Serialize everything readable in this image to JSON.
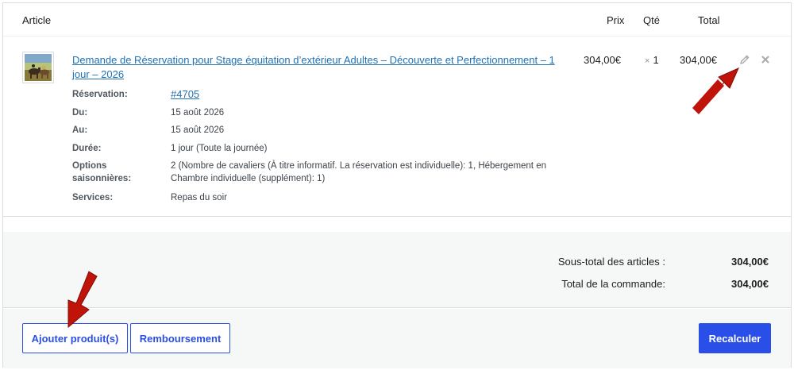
{
  "table": {
    "col_article": "Article",
    "col_prix": "Prix",
    "col_qte": "Qté",
    "col_total": "Total"
  },
  "item": {
    "title": "Demande de Réservation pour Stage équitation d’extérieur Adultes – Découverte et Perfectionnement – 1 jour – 2026",
    "unit_price": "304,00€",
    "qty_symbol": "×",
    "qty": "1",
    "line_total": "304,00€",
    "edit_icon": "pencil-icon",
    "delete_icon": "close-icon",
    "meta": [
      {
        "key": "Réservation:",
        "value": "#4705"
      },
      {
        "key": "Du:",
        "value": "15 août 2026"
      },
      {
        "key": "Au:",
        "value": "15 août 2026"
      },
      {
        "key": "Durée:",
        "value": "1 jour (Toute la journée)"
      },
      {
        "key": "Options saisonnières:",
        "value": "2 (Nombre de cavaliers (À titre informatif. La réservation est individuelle): 1, Hébergement en Chambre individuelle (supplément): 1)"
      },
      {
        "key": "Services:",
        "value": "Repas du soir"
      }
    ]
  },
  "totals": {
    "subtotal_label": "Sous-total des articles :",
    "subtotal_value": "304,00€",
    "order_total_label": "Total de la commande:",
    "order_total_value": "304,00€"
  },
  "actions": {
    "add_products": "Ajouter produit(s)",
    "refund": "Remboursement",
    "recalculate": "Recalculer"
  },
  "colors": {
    "accent": "#2a4ee8",
    "link": "#2271b1",
    "annotation_arrow": "#c0140b"
  }
}
